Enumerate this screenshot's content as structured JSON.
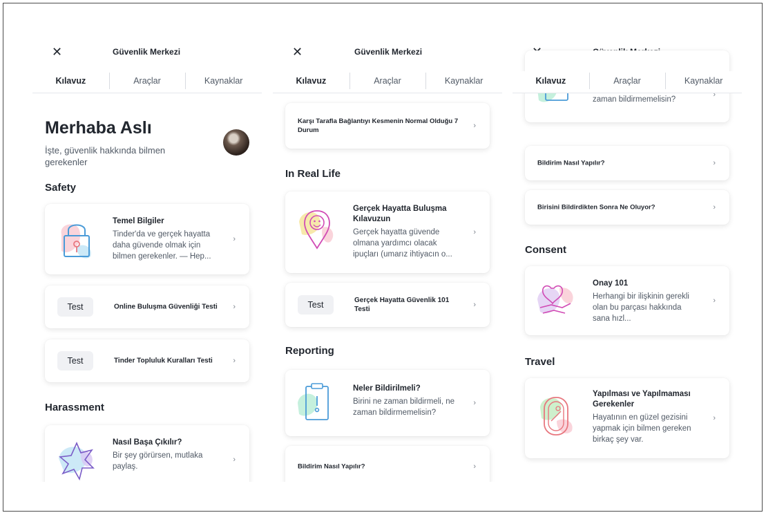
{
  "header_title": "Güvenlik Merkezi",
  "tabs": [
    "Kılavuz",
    "Araçlar",
    "Kaynaklar"
  ],
  "close_icon": "close-icon",
  "chevron": "›",
  "screen1": {
    "greeting": "Merhaba Aslı",
    "subtitle": "İşte, güvenlik hakkında bilmen gerekenler",
    "safety_heading": "Safety",
    "basics_title": "Temel Bilgiler",
    "basics_desc": "Tinder'da ve gerçek hayatta daha güvende olmak için bilmen gerekenler. — Hep...",
    "test_badge": "Test",
    "online_test": "Online Buluşma Güvenliği Testi",
    "community_test": "Tinder Topluluk Kuralları Testi",
    "harassment_heading": "Harassment",
    "cope_title": "Nasıl Başa Çıkılır?",
    "cope_desc": "Bir şey görürsen, mutlaka paylaş."
  },
  "screen2": {
    "unmatch_title": "Karşı Tarafla Bağlantıyı Kesmenin Normal Olduğu 7 Durum",
    "irl_heading": "In Real Life",
    "meet_title": "Gerçek Hayatta Buluşma Kılavuzun",
    "meet_desc": "Gerçek hayatta güvende olmana yardımcı olacak ipuçları (umarız ihtiyacın o...",
    "test_badge": "Test",
    "irl_test": "Gerçek Hayatta Güvenlik 101 Testi",
    "reporting_heading": "Reporting",
    "report_title": "Neler Bildirilmeli?",
    "report_desc": "Birini ne zaman bildirmeli, ne zaman bildirmemelisin?",
    "how_report": "Bildirim Nasıl Yapılır?"
  },
  "screen3": {
    "report_desc": "Birini ne zaman bildirmeli, ne zaman bildirmemelisin?",
    "how_report": "Bildirim Nasıl Yapılır?",
    "after_report": "Birisini Bildirdikten Sonra Ne Oluyor?",
    "consent_heading": "Consent",
    "consent_title": "Onay 101",
    "consent_desc": "Herhangi bir ilişkinin gerekli olan bu parçası hakkında sana hızl...",
    "travel_heading": "Travel",
    "travel_title": "Yapılması ve Yapılmaması Gerekenler",
    "travel_desc": "Hayatının en güzel gezisini yapmak için bilmen gereken birkaç şey var."
  }
}
